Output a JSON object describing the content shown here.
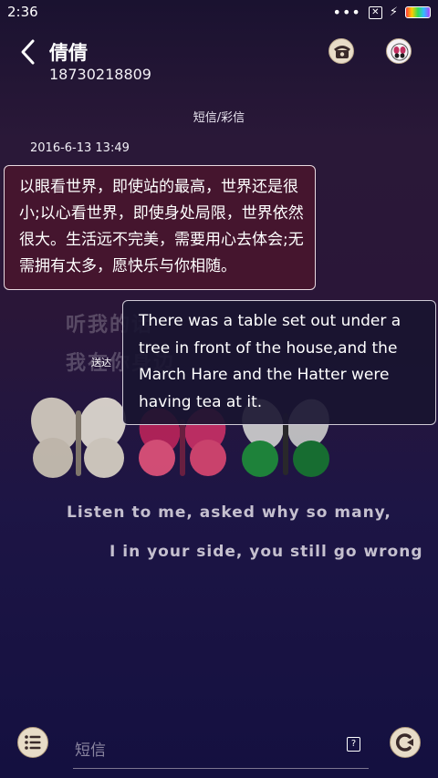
{
  "status_bar": {
    "time": "2:36",
    "icons": [
      "more-dots-icon",
      "close-box-icon",
      "charging-bolt-icon",
      "battery-icon"
    ],
    "battery_colors": [
      "#ff3b3b",
      "#ffcc00",
      "#33dd55",
      "#33bbff",
      "#aa44ff"
    ]
  },
  "header": {
    "contact_name": "倩倩",
    "phone_number": "18730218809",
    "icons": [
      "back-arrow-icon",
      "phone-call-icon",
      "contact-avatar-icon"
    ]
  },
  "conversation": {
    "channel_label": "短信/彩信",
    "timestamp": "2016-6-13 13:49",
    "received_message": "以眼看世界，即使站的最高，世界还是很小;以心看世界，即使身处局限，世界依然很大。生活远不完美，需要用心去体会;无需拥有太多，愿快乐与你相随。",
    "sent_status": "送达",
    "sent_message": "There was a table set out under a tree in front of the house,and the March Hare and the Hatter were having tea at it."
  },
  "wallpaper": {
    "chinese_line1": "听我的话",
    "chinese_line2": "我在你身边",
    "english_line1": "Listen to me, asked why so many,",
    "english_line2": "I in your side, you still go wrong",
    "butterfly_colors": [
      "#e6e0d5",
      "#e0527a",
      "#1e8c3a"
    ]
  },
  "composer": {
    "placeholder": "短信",
    "icons": [
      "menu-list-icon",
      "help-box-icon",
      "send-icon"
    ]
  },
  "colors": {
    "received_bubble": "#48162e",
    "sent_bubble": "#181430",
    "button_face": "#e8dcc8"
  }
}
